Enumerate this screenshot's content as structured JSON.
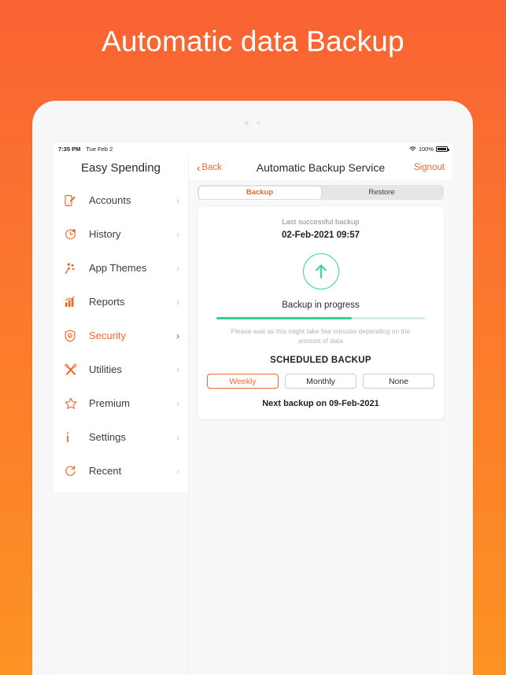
{
  "headline": "Automatic data Backup",
  "theme": {
    "gradient_top": "#F96233",
    "gradient_bottom": "#FD9325",
    "accent_orange": "#F4682B",
    "accent_green": "#35CE8D",
    "progress_track": "#D5EEE1"
  },
  "status_bar": {
    "time": "7:35 PM",
    "date": "Tue Feb 2",
    "battery_percent": "100%",
    "wifi_icon": "wifi-icon",
    "battery_icon": "battery-full-icon"
  },
  "nav": {
    "app_title": "Easy Spending",
    "back_label": "Back",
    "back_icon": "chevron-left-icon",
    "screen_title": "Automatic Backup Service",
    "signout_label": "Signout"
  },
  "sidebar": {
    "items": [
      {
        "label": "Accounts",
        "icon": "phone-edit-icon",
        "active": false,
        "chevron": "›"
      },
      {
        "label": "History",
        "icon": "clock-icon",
        "active": false,
        "chevron": "›"
      },
      {
        "label": "App Themes",
        "icon": "paint-dots-icon",
        "active": false,
        "chevron": "›"
      },
      {
        "label": "Reports",
        "icon": "bar-chart-icon",
        "active": false,
        "chevron": "›"
      },
      {
        "label": "Security",
        "icon": "shield-icon",
        "active": true,
        "chevron": "›"
      },
      {
        "label": "Utilities",
        "icon": "tools-icon",
        "active": false,
        "chevron": "›"
      },
      {
        "label": "Premium",
        "icon": "star-icon",
        "active": false,
        "chevron": "›"
      },
      {
        "label": "Settings",
        "icon": "info-icon",
        "active": false,
        "chevron": "›"
      },
      {
        "label": "Recent",
        "icon": "refresh-icon",
        "active": false,
        "chevron": "›"
      }
    ]
  },
  "segment": {
    "tabs": [
      {
        "label": "Backup",
        "active": true
      },
      {
        "label": "Restore",
        "active": false
      }
    ]
  },
  "card": {
    "last_backup_label": "Last successful backup",
    "last_backup_value": "02-Feb-2021 09:57",
    "upload_icon": "upload-arrow-circle-icon",
    "progress_label": "Backup in progress",
    "progress_percent": 65,
    "wait_text": "Please wait as this might take few minutes depending on the amount of  data",
    "scheduled_title": "SCHEDULED BACKUP",
    "schedule_options": [
      {
        "label": "Weekly",
        "selected": true
      },
      {
        "label": "Monthly",
        "selected": false
      },
      {
        "label": "None",
        "selected": false
      }
    ],
    "next_backup": "Next backup on 09-Feb-2021"
  }
}
